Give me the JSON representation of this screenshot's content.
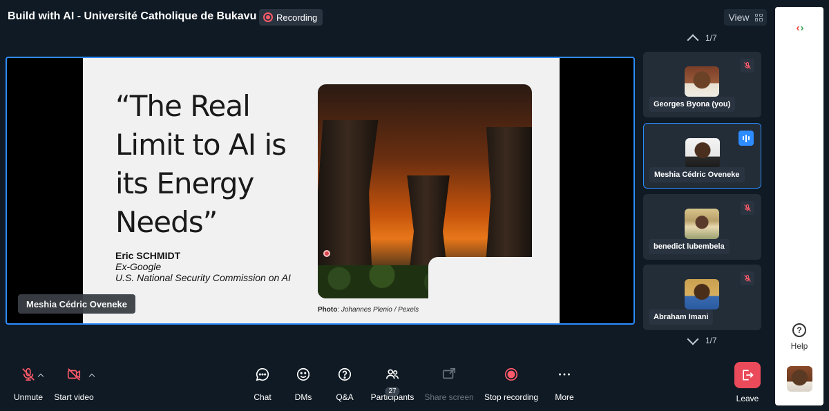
{
  "header": {
    "meeting_title": "Build with AI - Université Catholique de Bukavu",
    "recording_label": "Recording",
    "view_label": "View"
  },
  "stage": {
    "slide": {
      "quote": "“The Real Limit to AI is its Energy Needs”",
      "author_name": "Eric SCHMIDT",
      "author_role1": "Ex-Google",
      "author_role2": "U.S. National Security Commission on AI",
      "credit_label": "Photo",
      "credit_text": ": Johannes Plenio / Pexels"
    },
    "speaker_label": "Meshia Cédric Oveneke"
  },
  "participants_panel": {
    "page_top": "1/7",
    "page_bottom": "1/7",
    "tiles": [
      {
        "name": "Georges Byona (you)",
        "muted": true,
        "active": false
      },
      {
        "name": "Meshia Cédric Oveneke",
        "muted": false,
        "active": true
      },
      {
        "name": "benedict lubembela",
        "muted": true,
        "active": false
      },
      {
        "name": "Abraham Imani",
        "muted": true,
        "active": false
      }
    ]
  },
  "toolbar": {
    "unmute": "Unmute",
    "start_video": "Start video",
    "chat": "Chat",
    "dms": "DMs",
    "qa": "Q&A",
    "participants": "Participants",
    "participants_count": "27",
    "share_screen": "Share screen",
    "stop_recording": "Stop recording",
    "more": "More",
    "leave": "Leave"
  },
  "side_panel": {
    "help_label": "Help"
  },
  "colors": {
    "accent": "#2d8cff",
    "danger": "#ea4a5a",
    "background": "#0f1a24",
    "tile": "#222d38"
  }
}
